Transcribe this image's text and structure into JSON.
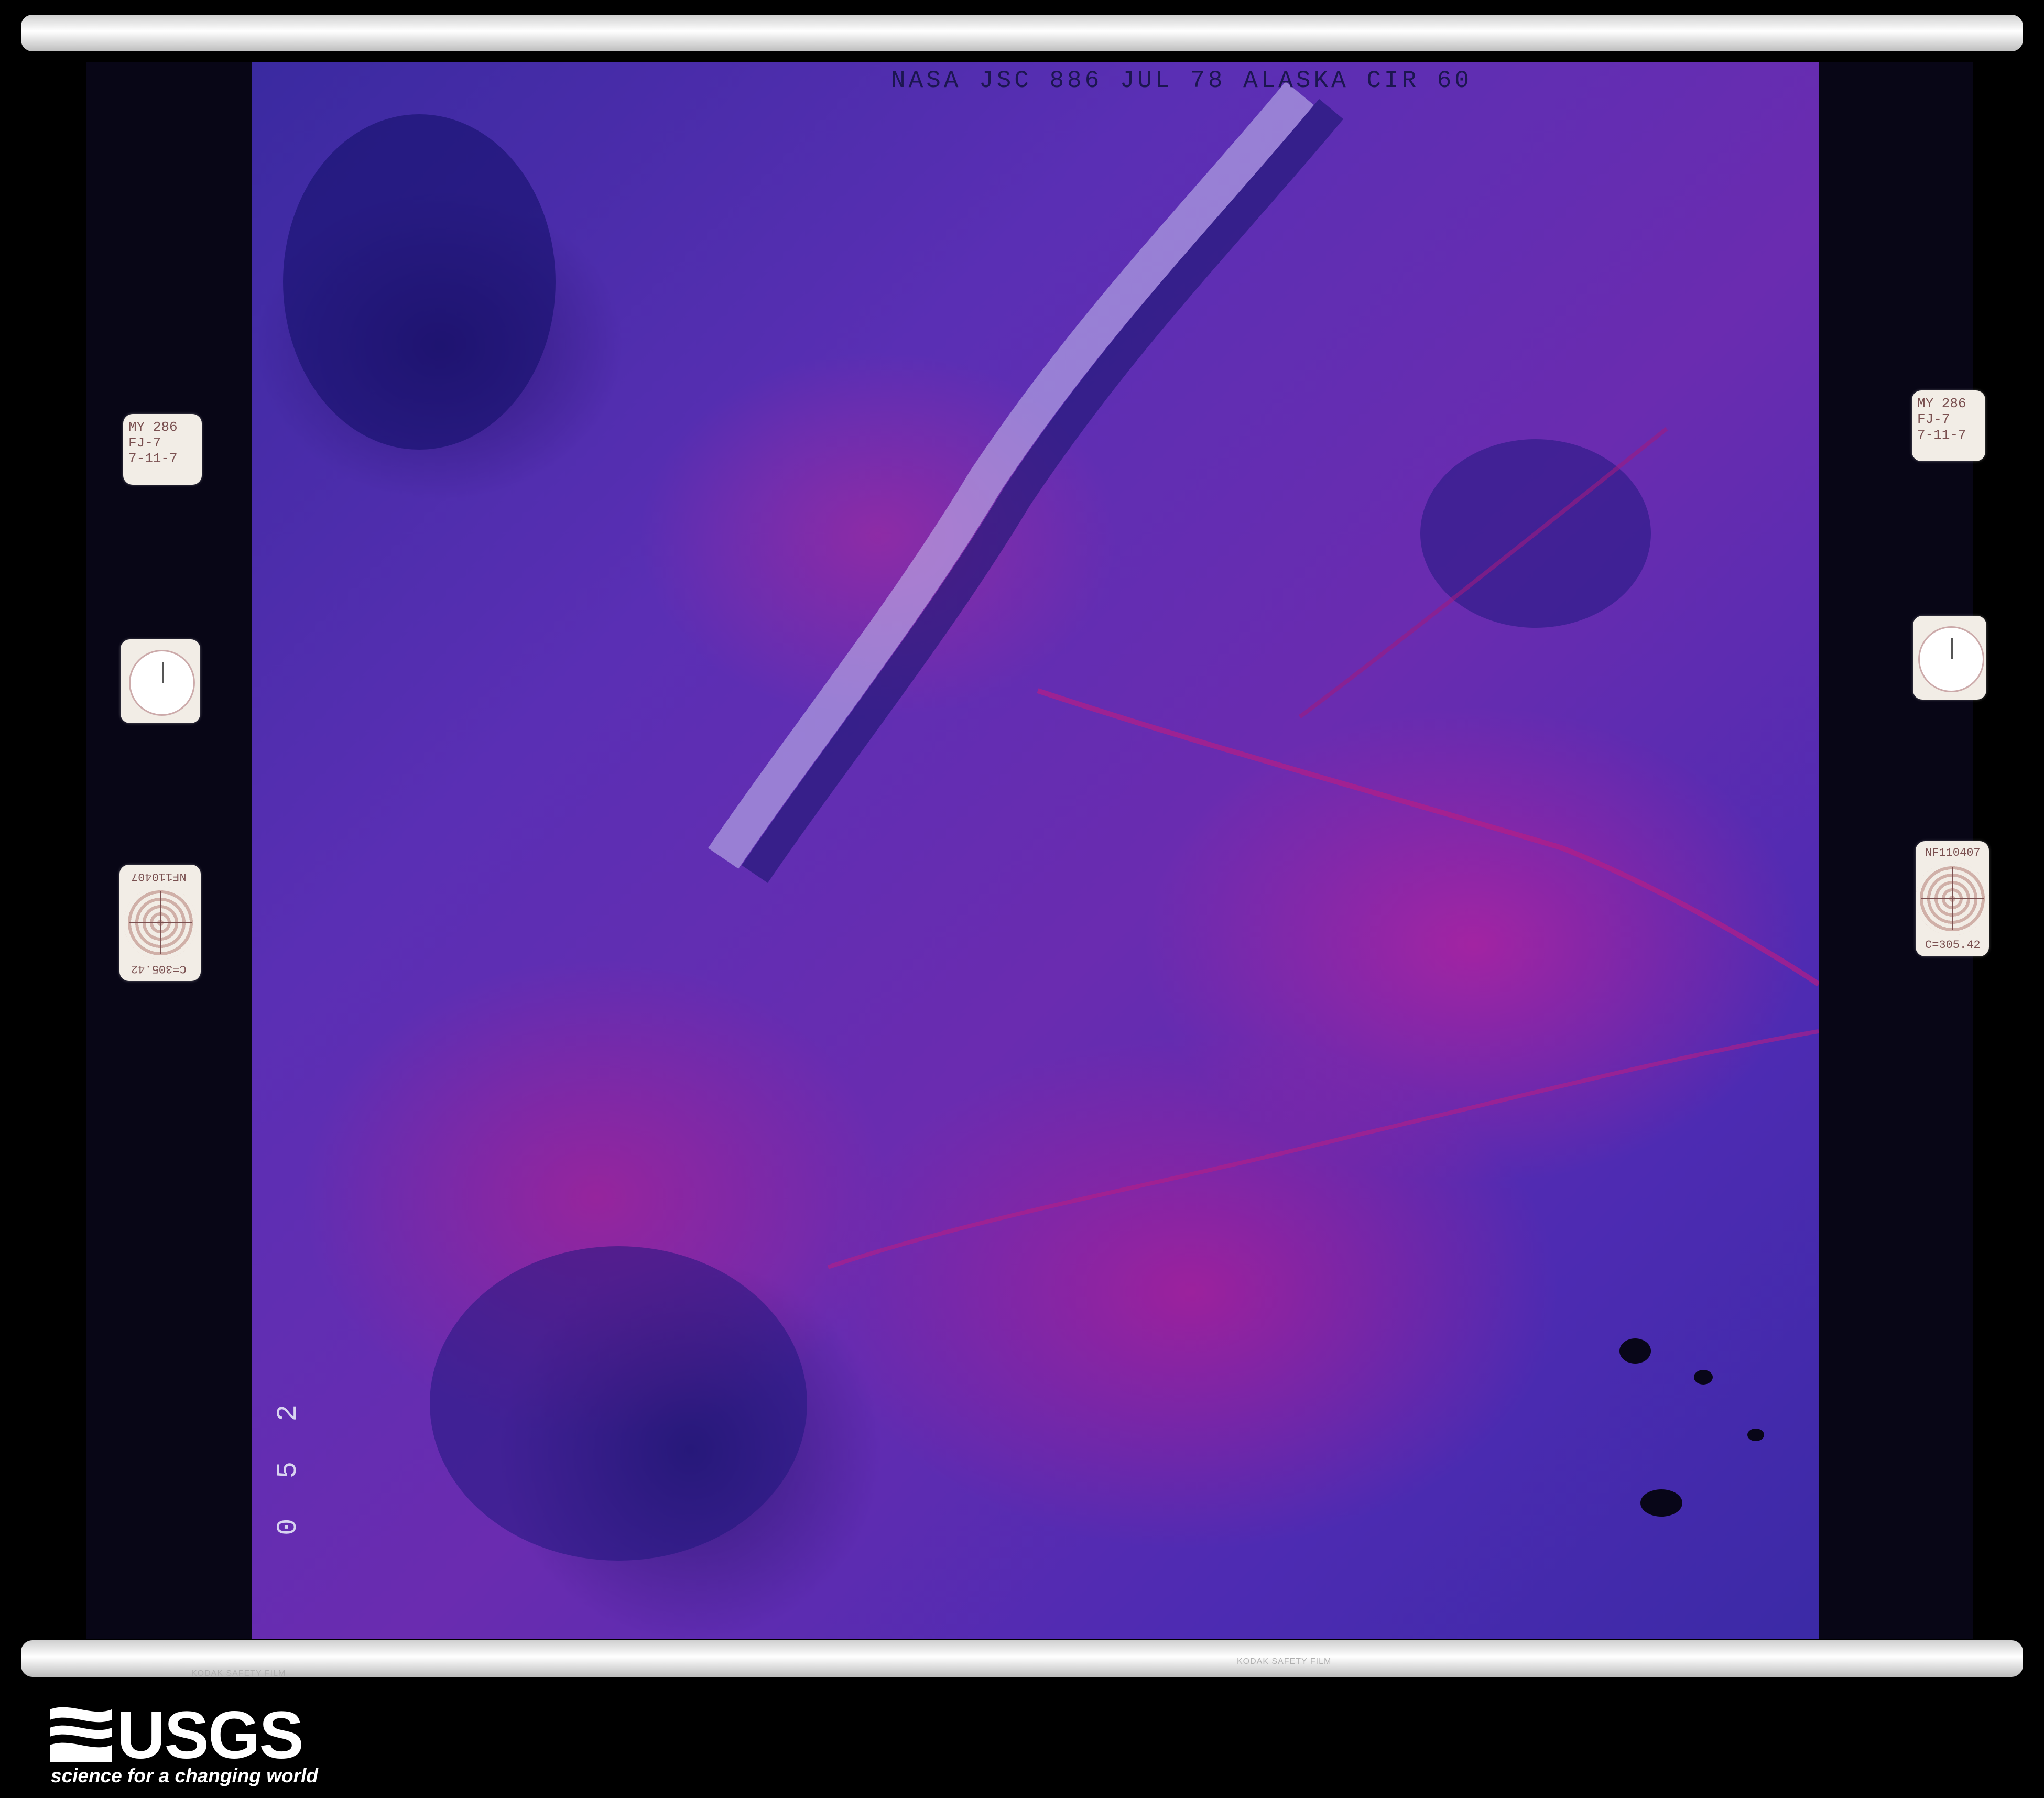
{
  "image": {
    "header_text": "NASA JSC 886 JUL 78 ALASKA CIR 60",
    "frame_number": "0 5 2",
    "left_card_text": "MY 286\nFJ-7\n7-11-7",
    "right_card_text": "MY 286\nFJ-7\n7-11-7",
    "target_serial": "NF110407",
    "target_calibration": "C=305.42",
    "film_edge_left": "KODAK SAFETY FILM",
    "film_edge_right": "KODAK SAFETY FILM"
  },
  "logo": {
    "name": "USGS",
    "tagline": "science for a changing world"
  },
  "colors": {
    "film_base": "#080616",
    "ir_vegetation": "#c8208f",
    "terrain_blue": "#3b2aa6",
    "background": "#000000"
  }
}
